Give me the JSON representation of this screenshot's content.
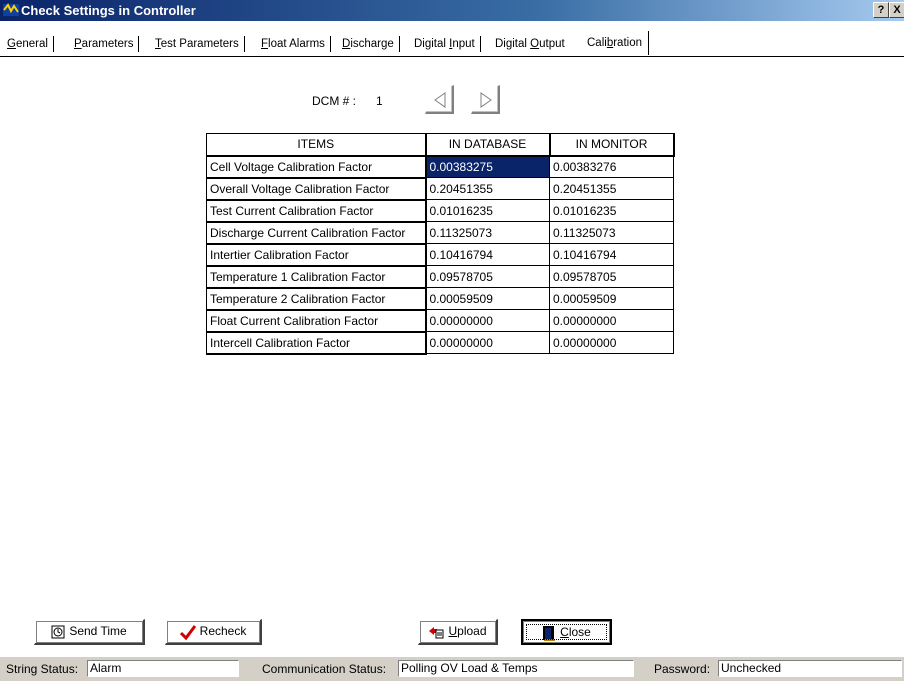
{
  "window": {
    "title": "Check Settings in Controller",
    "help_button": "?",
    "close_button": "X"
  },
  "tabs": [
    {
      "label": "General",
      "underline": "G",
      "rest": "eneral"
    },
    {
      "label": "Parameters",
      "underline": "P",
      "rest": "arameters"
    },
    {
      "label": "Test Parameters",
      "underline": "T",
      "rest": "est Parameters"
    },
    {
      "label": "Float Alarms",
      "underline": "F",
      "rest": "loat Alarms"
    },
    {
      "label": "Discharge",
      "underline": "D",
      "rest": "ischarge"
    },
    {
      "label": "Digital Input",
      "pre": "Digital ",
      "underline": "I",
      "rest": "nput"
    },
    {
      "label": "Digital Output",
      "pre": "Digital ",
      "underline": "O",
      "rest": "utput"
    },
    {
      "label": "Calibration",
      "pre": "Cali",
      "underline": "b",
      "rest": "ration",
      "active": true
    }
  ],
  "dcm": {
    "label": "DCM # :",
    "value": "1"
  },
  "table": {
    "headers": [
      "ITEMS",
      "IN DATABASE",
      "IN MONITOR"
    ],
    "rows": [
      [
        "Cell Voltage Calibration Factor",
        "0.00383275",
        "0.00383276"
      ],
      [
        "Overall Voltage Calibration Factor",
        "0.20451355",
        "0.20451355"
      ],
      [
        "Test Current Calibration Factor",
        "0.01016235",
        "0.01016235"
      ],
      [
        "Discharge Current Calibration Factor",
        "0.11325073",
        "0.11325073"
      ],
      [
        "Intertier Calibration Factor",
        "0.10416794",
        "0.10416794"
      ],
      [
        "Temperature 1 Calibration Factor",
        "0.09578705",
        "0.09578705"
      ],
      [
        "Temperature 2 Calibration Factor",
        "0.00059509",
        "0.00059509"
      ],
      [
        "Float Current Calibration Factor",
        "0.00000000",
        "0.00000000"
      ],
      [
        "Intercell Calibration Factor",
        "0.00000000",
        "0.00000000"
      ]
    ],
    "selected": {
      "row": 0,
      "col": 1
    }
  },
  "buttons": {
    "send_time": "Send Time",
    "recheck": "Recheck",
    "upload_u": "U",
    "upload_rest": "pload",
    "close_u": "C",
    "close_rest": "lose"
  },
  "status": {
    "string_label": "String Status:",
    "string_value": "Alarm",
    "comm_label": "Communication Status:",
    "comm_value": "Polling OV Load & Temps",
    "password_label": "Password:",
    "password_value": "Unchecked"
  },
  "colors": {
    "selection": "#0a246a",
    "titlebar_start": "#0a246a",
    "titlebar_end": "#a6caf0",
    "statusbar": "#d4d0c8"
  }
}
